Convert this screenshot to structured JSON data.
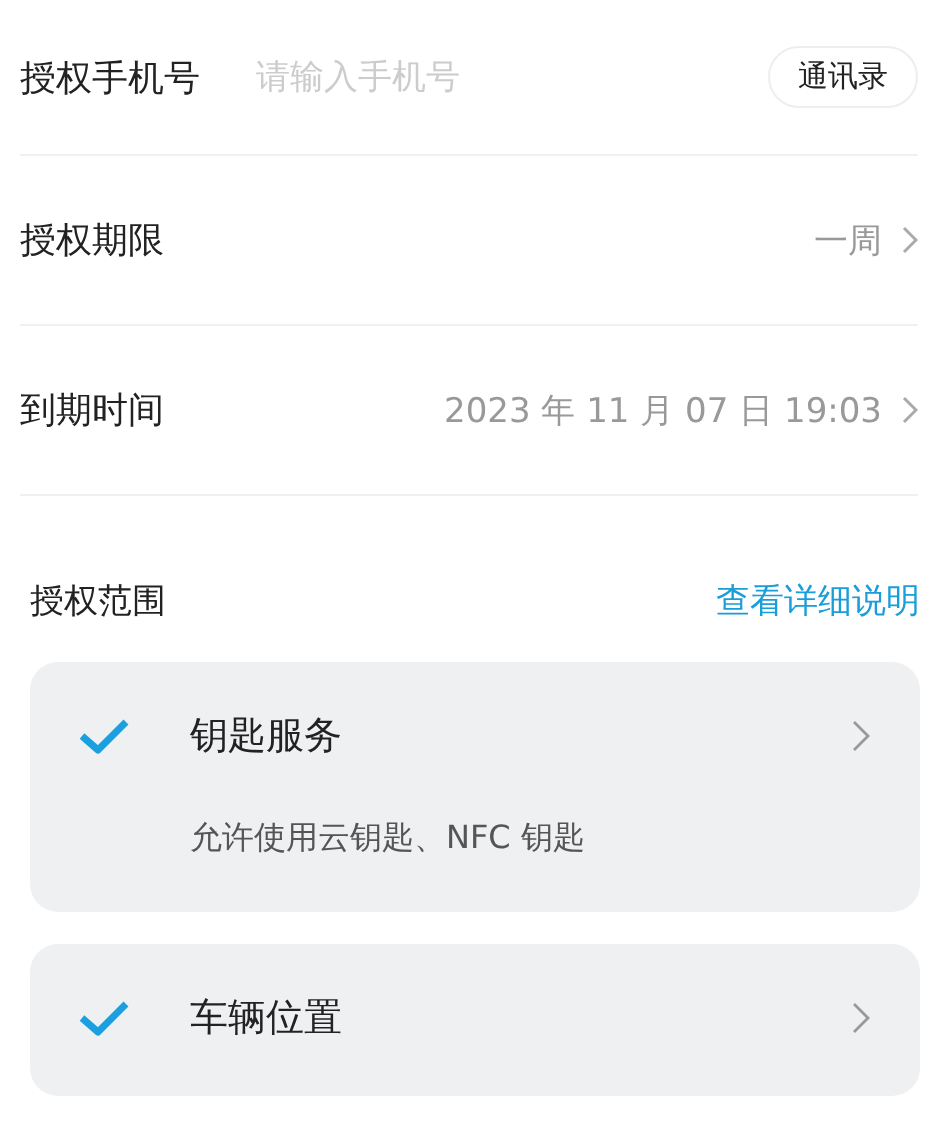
{
  "phone_row": {
    "label": "授权手机号",
    "placeholder": "请输入手机号",
    "contacts_button": "通讯录"
  },
  "rows": [
    {
      "label": "授权期限",
      "value": "一周"
    },
    {
      "label": "到期时间",
      "value": "2023 年 11 月 07 日 19:03"
    }
  ],
  "scope": {
    "title": "授权范围",
    "details_link": "查看详细说明",
    "items": [
      {
        "name": "钥匙服务",
        "description": "允许使用云钥匙、NFC 钥匙",
        "checked": true
      },
      {
        "name": "车辆位置",
        "checked": true
      }
    ]
  }
}
